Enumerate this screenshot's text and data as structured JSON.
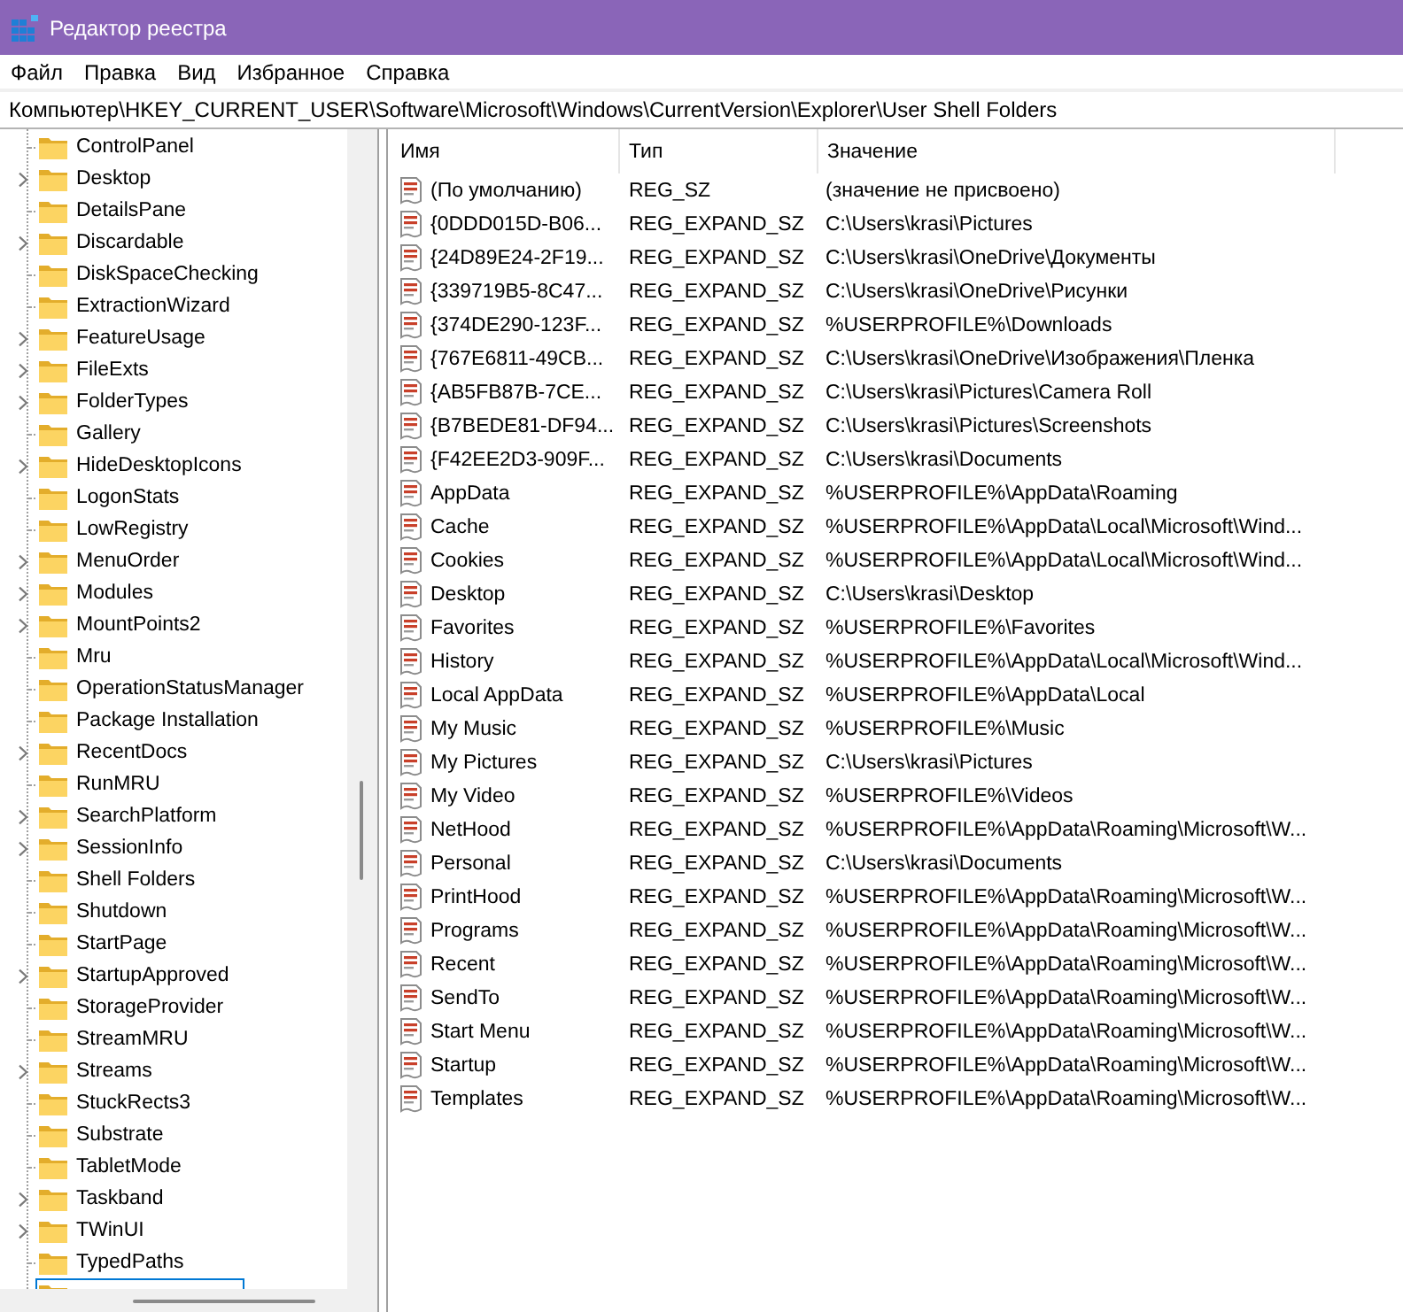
{
  "window": {
    "title": "Редактор реестра"
  },
  "menu": [
    "Файл",
    "Правка",
    "Вид",
    "Избранное",
    "Справка"
  ],
  "address": "Компьютер\\HKEY_CURRENT_USER\\Software\\Microsoft\\Windows\\CurrentVersion\\Explorer\\User Shell Folders",
  "tree": {
    "items": [
      {
        "label": "ControlPanel",
        "expandable": false,
        "selected": false
      },
      {
        "label": "Desktop",
        "expandable": true,
        "selected": false
      },
      {
        "label": "DetailsPane",
        "expandable": false,
        "selected": false
      },
      {
        "label": "Discardable",
        "expandable": true,
        "selected": false
      },
      {
        "label": "DiskSpaceChecking",
        "expandable": false,
        "selected": false
      },
      {
        "label": "ExtractionWizard",
        "expandable": false,
        "selected": false
      },
      {
        "label": "FeatureUsage",
        "expandable": true,
        "selected": false
      },
      {
        "label": "FileExts",
        "expandable": true,
        "selected": false
      },
      {
        "label": "FolderTypes",
        "expandable": true,
        "selected": false
      },
      {
        "label": "Gallery",
        "expandable": false,
        "selected": false
      },
      {
        "label": "HideDesktopIcons",
        "expandable": true,
        "selected": false
      },
      {
        "label": "LogonStats",
        "expandable": false,
        "selected": false
      },
      {
        "label": "LowRegistry",
        "expandable": false,
        "selected": false
      },
      {
        "label": "MenuOrder",
        "expandable": true,
        "selected": false
      },
      {
        "label": "Modules",
        "expandable": true,
        "selected": false
      },
      {
        "label": "MountPoints2",
        "expandable": true,
        "selected": false
      },
      {
        "label": "Mru",
        "expandable": false,
        "selected": false
      },
      {
        "label": "OperationStatusManager",
        "expandable": false,
        "selected": false
      },
      {
        "label": "Package Installation",
        "expandable": false,
        "selected": false
      },
      {
        "label": "RecentDocs",
        "expandable": true,
        "selected": false
      },
      {
        "label": "RunMRU",
        "expandable": false,
        "selected": false
      },
      {
        "label": "SearchPlatform",
        "expandable": true,
        "selected": false
      },
      {
        "label": "SessionInfo",
        "expandable": true,
        "selected": false
      },
      {
        "label": "Shell Folders",
        "expandable": false,
        "selected": false
      },
      {
        "label": "Shutdown",
        "expandable": false,
        "selected": false
      },
      {
        "label": "StartPage",
        "expandable": false,
        "selected": false
      },
      {
        "label": "StartupApproved",
        "expandable": true,
        "selected": false
      },
      {
        "label": "StorageProvider",
        "expandable": false,
        "selected": false
      },
      {
        "label": "StreamMRU",
        "expandable": false,
        "selected": false
      },
      {
        "label": "Streams",
        "expandable": true,
        "selected": false
      },
      {
        "label": "StuckRects3",
        "expandable": false,
        "selected": false
      },
      {
        "label": "Substrate",
        "expandable": false,
        "selected": false
      },
      {
        "label": "TabletMode",
        "expandable": false,
        "selected": false
      },
      {
        "label": "Taskband",
        "expandable": true,
        "selected": false
      },
      {
        "label": "TWinUI",
        "expandable": true,
        "selected": false
      },
      {
        "label": "TypedPaths",
        "expandable": false,
        "selected": false
      },
      {
        "expandable": false,
        "selected": true
      }
    ]
  },
  "values": {
    "columns": [
      "Имя",
      "Тип",
      "Значение"
    ],
    "rows": [
      {
        "name": "(По умолчанию)",
        "type": "REG_SZ",
        "data": "(значение не присвоено)"
      },
      {
        "name": "{0DDD015D-B06...",
        "type": "REG_EXPAND_SZ",
        "data": "C:\\Users\\krasi\\Pictures"
      },
      {
        "name": "{24D89E24-2F19...",
        "type": "REG_EXPAND_SZ",
        "data": "C:\\Users\\krasi\\OneDrive\\Документы"
      },
      {
        "name": "{339719B5-8C47...",
        "type": "REG_EXPAND_SZ",
        "data": "C:\\Users\\krasi\\OneDrive\\Рисунки"
      },
      {
        "name": "{374DE290-123F...",
        "type": "REG_EXPAND_SZ",
        "data": "%USERPROFILE%\\Downloads"
      },
      {
        "name": "{767E6811-49CB...",
        "type": "REG_EXPAND_SZ",
        "data": "C:\\Users\\krasi\\OneDrive\\Изображения\\Пленка"
      },
      {
        "name": "{AB5FB87B-7CE...",
        "type": "REG_EXPAND_SZ",
        "data": "C:\\Users\\krasi\\Pictures\\Camera Roll"
      },
      {
        "name": "{B7BEDE81-DF94...",
        "type": "REG_EXPAND_SZ",
        "data": "C:\\Users\\krasi\\Pictures\\Screenshots"
      },
      {
        "name": "{F42EE2D3-909F...",
        "type": "REG_EXPAND_SZ",
        "data": "C:\\Users\\krasi\\Documents"
      },
      {
        "name": "AppData",
        "type": "REG_EXPAND_SZ",
        "data": "%USERPROFILE%\\AppData\\Roaming"
      },
      {
        "name": "Cache",
        "type": "REG_EXPAND_SZ",
        "data": "%USERPROFILE%\\AppData\\Local\\Microsoft\\Wind..."
      },
      {
        "name": "Cookies",
        "type": "REG_EXPAND_SZ",
        "data": "%USERPROFILE%\\AppData\\Local\\Microsoft\\Wind..."
      },
      {
        "name": "Desktop",
        "type": "REG_EXPAND_SZ",
        "data": "C:\\Users\\krasi\\Desktop"
      },
      {
        "name": "Favorites",
        "type": "REG_EXPAND_SZ",
        "data": "%USERPROFILE%\\Favorites"
      },
      {
        "name": "History",
        "type": "REG_EXPAND_SZ",
        "data": "%USERPROFILE%\\AppData\\Local\\Microsoft\\Wind..."
      },
      {
        "name": "Local AppData",
        "type": "REG_EXPAND_SZ",
        "data": "%USERPROFILE%\\AppData\\Local"
      },
      {
        "name": "My Music",
        "type": "REG_EXPAND_SZ",
        "data": "%USERPROFILE%\\Music"
      },
      {
        "name": "My Pictures",
        "type": "REG_EXPAND_SZ",
        "data": "C:\\Users\\krasi\\Pictures"
      },
      {
        "name": "My Video",
        "type": "REG_EXPAND_SZ",
        "data": "%USERPROFILE%\\Videos"
      },
      {
        "name": "NetHood",
        "type": "REG_EXPAND_SZ",
        "data": "%USERPROFILE%\\AppData\\Roaming\\Microsoft\\W..."
      },
      {
        "name": "Personal",
        "type": "REG_EXPAND_SZ",
        "data": "C:\\Users\\krasi\\Documents"
      },
      {
        "name": "PrintHood",
        "type": "REG_EXPAND_SZ",
        "data": "%USERPROFILE%\\AppData\\Roaming\\Microsoft\\W..."
      },
      {
        "name": "Programs",
        "type": "REG_EXPAND_SZ",
        "data": "%USERPROFILE%\\AppData\\Roaming\\Microsoft\\W..."
      },
      {
        "name": "Recent",
        "type": "REG_EXPAND_SZ",
        "data": "%USERPROFILE%\\AppData\\Roaming\\Microsoft\\W..."
      },
      {
        "name": "SendTo",
        "type": "REG_EXPAND_SZ",
        "data": "%USERPROFILE%\\AppData\\Roaming\\Microsoft\\W..."
      },
      {
        "name": "Start Menu",
        "type": "REG_EXPAND_SZ",
        "data": "%USERPROFILE%\\AppData\\Roaming\\Microsoft\\W..."
      },
      {
        "name": "Startup",
        "type": "REG_EXPAND_SZ",
        "data": "%USERPROFILE%\\AppData\\Roaming\\Microsoft\\W..."
      },
      {
        "name": "Templates",
        "type": "REG_EXPAND_SZ",
        "data": "%USERPROFILE%\\AppData\\Roaming\\Microsoft\\W..."
      }
    ]
  }
}
